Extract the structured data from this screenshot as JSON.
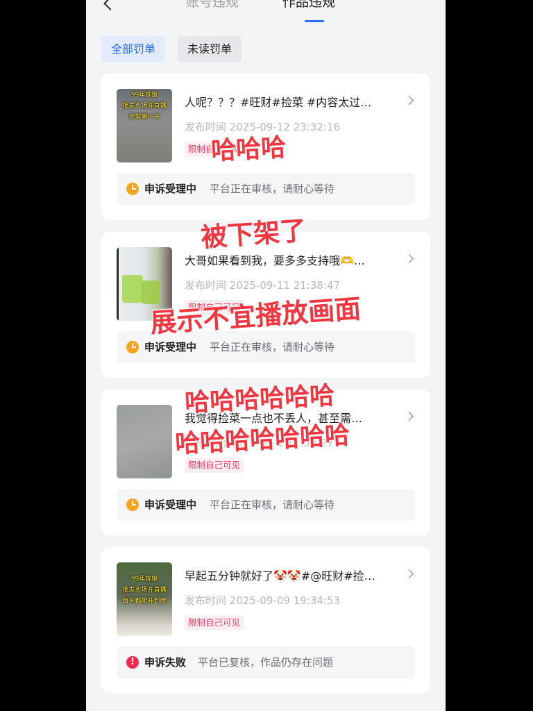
{
  "header": {
    "back": "back-arrow-icon",
    "tabs": [
      "账号违规",
      "作品违规"
    ],
    "active_tab": 1
  },
  "filters": [
    "全部罚单",
    "未读罚单"
  ],
  "colors": {
    "accent": "#2d6df6",
    "tag": "#f04060",
    "pending": "#f7a51c",
    "failed": "#f2274b",
    "overlay": "#f23640"
  },
  "items": [
    {
      "title": "人呢？？？#旺财#捡菜 #内容太过…",
      "time": "发布时间 2025-09-12 23:32:16",
      "tag": "限制自己可见",
      "thumb_text": [
        "99年嫁娘",
        "批发市场开直播",
        "捡菜第十天"
      ],
      "appeal_status": "申诉受理中",
      "appeal_msg": "平台正在审核，请耐心等待"
    },
    {
      "title": "大哥如果看到我，要多多支持哦🫶…",
      "time": "发布时间 2025-09-11 21:38:47",
      "tag": "限制自己可见",
      "thumb_text": [],
      "appeal_status": "申诉受理中",
      "appeal_msg": "平台正在审核，请耐心等待"
    },
    {
      "title": "我觉得捡菜一点也不丢人，甚至需…",
      "time": "发布时间 2025-09-1 11:58:27",
      "tag": "限制自己可见",
      "thumb_text": [],
      "appeal_status": "申诉受理中",
      "appeal_msg": "平台正在审核，请耐心等待"
    },
    {
      "title": "早起五分钟就好了🤡🤡#@旺财#捡…",
      "time": "发布时间 2025-09-09 19:34:53",
      "tag": "限制自己可见",
      "thumb_text": [
        "99年嫁娘",
        "批发市场开直播",
        "每天都能开到哦"
      ],
      "appeal_status": "申诉失败",
      "appeal_msg": "平台已复核，作品仍存在问题"
    }
  ],
  "overlays": [
    "哈哈哈",
    "被下架了",
    "展示不宜播放画面",
    "哈哈哈哈哈哈",
    "哈哈哈哈哈哈哈"
  ]
}
